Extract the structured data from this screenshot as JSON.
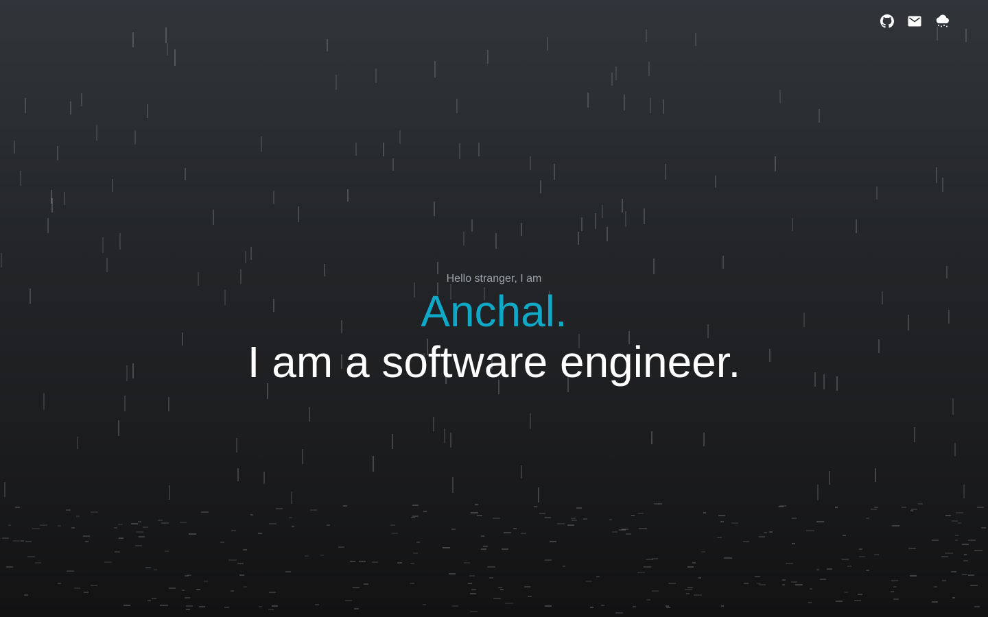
{
  "nav": {
    "links": [
      {
        "icon": "github-icon",
        "label": "GitHub"
      },
      {
        "icon": "mail-icon",
        "label": "Email"
      },
      {
        "icon": "rain-cloud-icon",
        "label": "Toggle rain"
      }
    ]
  },
  "hero": {
    "greeting": "Hello stranger, I am",
    "name": "Anchal.",
    "tagline": "I am a software engineer."
  },
  "colors": {
    "accent": "#0fa8c6",
    "text": "#ffffff",
    "muted": "#9ea4aa",
    "background_top": "#31353a",
    "background_bottom": "#121213",
    "rain": "#8a8d90"
  }
}
